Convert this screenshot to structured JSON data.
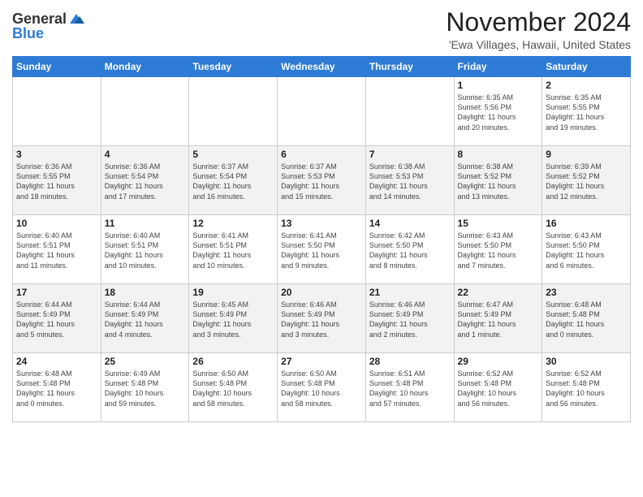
{
  "header": {
    "logo_general": "General",
    "logo_blue": "Blue",
    "month": "November 2024",
    "location": "'Ewa Villages, Hawaii, United States"
  },
  "weekdays": [
    "Sunday",
    "Monday",
    "Tuesday",
    "Wednesday",
    "Thursday",
    "Friday",
    "Saturday"
  ],
  "weeks": [
    [
      {
        "day": "",
        "info": ""
      },
      {
        "day": "",
        "info": ""
      },
      {
        "day": "",
        "info": ""
      },
      {
        "day": "",
        "info": ""
      },
      {
        "day": "",
        "info": ""
      },
      {
        "day": "1",
        "info": "Sunrise: 6:35 AM\nSunset: 5:56 PM\nDaylight: 11 hours\nand 20 minutes."
      },
      {
        "day": "2",
        "info": "Sunrise: 6:35 AM\nSunset: 5:55 PM\nDaylight: 11 hours\nand 19 minutes."
      }
    ],
    [
      {
        "day": "3",
        "info": "Sunrise: 6:36 AM\nSunset: 5:55 PM\nDaylight: 11 hours\nand 18 minutes."
      },
      {
        "day": "4",
        "info": "Sunrise: 6:36 AM\nSunset: 5:54 PM\nDaylight: 11 hours\nand 17 minutes."
      },
      {
        "day": "5",
        "info": "Sunrise: 6:37 AM\nSunset: 5:54 PM\nDaylight: 11 hours\nand 16 minutes."
      },
      {
        "day": "6",
        "info": "Sunrise: 6:37 AM\nSunset: 5:53 PM\nDaylight: 11 hours\nand 15 minutes."
      },
      {
        "day": "7",
        "info": "Sunrise: 6:38 AM\nSunset: 5:53 PM\nDaylight: 11 hours\nand 14 minutes."
      },
      {
        "day": "8",
        "info": "Sunrise: 6:38 AM\nSunset: 5:52 PM\nDaylight: 11 hours\nand 13 minutes."
      },
      {
        "day": "9",
        "info": "Sunrise: 6:39 AM\nSunset: 5:52 PM\nDaylight: 11 hours\nand 12 minutes."
      }
    ],
    [
      {
        "day": "10",
        "info": "Sunrise: 6:40 AM\nSunset: 5:51 PM\nDaylight: 11 hours\nand 11 minutes."
      },
      {
        "day": "11",
        "info": "Sunrise: 6:40 AM\nSunset: 5:51 PM\nDaylight: 11 hours\nand 10 minutes."
      },
      {
        "day": "12",
        "info": "Sunrise: 6:41 AM\nSunset: 5:51 PM\nDaylight: 11 hours\nand 10 minutes."
      },
      {
        "day": "13",
        "info": "Sunrise: 6:41 AM\nSunset: 5:50 PM\nDaylight: 11 hours\nand 9 minutes."
      },
      {
        "day": "14",
        "info": "Sunrise: 6:42 AM\nSunset: 5:50 PM\nDaylight: 11 hours\nand 8 minutes."
      },
      {
        "day": "15",
        "info": "Sunrise: 6:43 AM\nSunset: 5:50 PM\nDaylight: 11 hours\nand 7 minutes."
      },
      {
        "day": "16",
        "info": "Sunrise: 6:43 AM\nSunset: 5:50 PM\nDaylight: 11 hours\nand 6 minutes."
      }
    ],
    [
      {
        "day": "17",
        "info": "Sunrise: 6:44 AM\nSunset: 5:49 PM\nDaylight: 11 hours\nand 5 minutes."
      },
      {
        "day": "18",
        "info": "Sunrise: 6:44 AM\nSunset: 5:49 PM\nDaylight: 11 hours\nand 4 minutes."
      },
      {
        "day": "19",
        "info": "Sunrise: 6:45 AM\nSunset: 5:49 PM\nDaylight: 11 hours\nand 3 minutes."
      },
      {
        "day": "20",
        "info": "Sunrise: 6:46 AM\nSunset: 5:49 PM\nDaylight: 11 hours\nand 3 minutes."
      },
      {
        "day": "21",
        "info": "Sunrise: 6:46 AM\nSunset: 5:49 PM\nDaylight: 11 hours\nand 2 minutes."
      },
      {
        "day": "22",
        "info": "Sunrise: 6:47 AM\nSunset: 5:49 PM\nDaylight: 11 hours\nand 1 minute."
      },
      {
        "day": "23",
        "info": "Sunrise: 6:48 AM\nSunset: 5:48 PM\nDaylight: 11 hours\nand 0 minutes."
      }
    ],
    [
      {
        "day": "24",
        "info": "Sunrise: 6:48 AM\nSunset: 5:48 PM\nDaylight: 11 hours\nand 0 minutes."
      },
      {
        "day": "25",
        "info": "Sunrise: 6:49 AM\nSunset: 5:48 PM\nDaylight: 10 hours\nand 59 minutes."
      },
      {
        "day": "26",
        "info": "Sunrise: 6:50 AM\nSunset: 5:48 PM\nDaylight: 10 hours\nand 58 minutes."
      },
      {
        "day": "27",
        "info": "Sunrise: 6:50 AM\nSunset: 5:48 PM\nDaylight: 10 hours\nand 58 minutes."
      },
      {
        "day": "28",
        "info": "Sunrise: 6:51 AM\nSunset: 5:48 PM\nDaylight: 10 hours\nand 57 minutes."
      },
      {
        "day": "29",
        "info": "Sunrise: 6:52 AM\nSunset: 5:48 PM\nDaylight: 10 hours\nand 56 minutes."
      },
      {
        "day": "30",
        "info": "Sunrise: 6:52 AM\nSunset: 5:48 PM\nDaylight: 10 hours\nand 56 minutes."
      }
    ]
  ]
}
